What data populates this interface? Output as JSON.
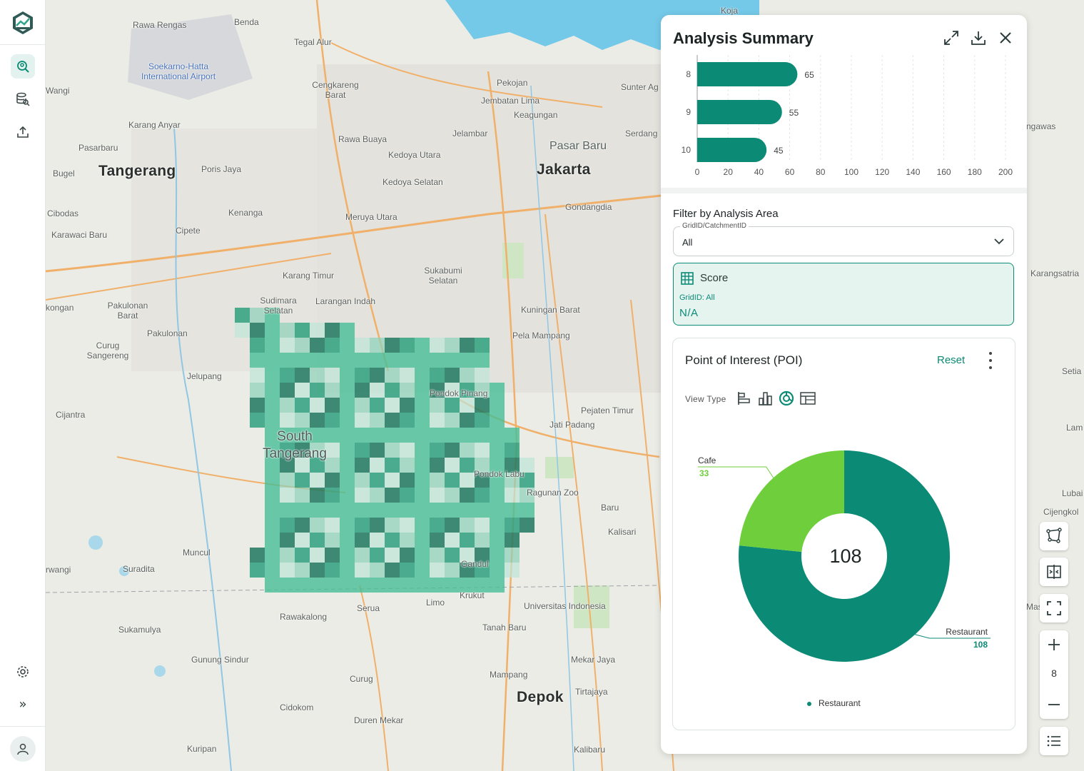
{
  "sidebar": {
    "logo": "app-logo",
    "items": [
      {
        "name": "analysis",
        "icon": "location-search-icon",
        "active": true
      },
      {
        "name": "datasets",
        "icon": "database-search-icon",
        "active": false
      },
      {
        "name": "upload",
        "icon": "upload-icon",
        "active": false
      }
    ],
    "settings_icon": "gear-icon",
    "expand_label": "»",
    "profile_icon": "user-icon"
  },
  "map": {
    "places": {
      "rawa_rengas": "Rawa Rengas",
      "benda": "Benda",
      "tegal_alur": "Tegal Alur",
      "airport": "Soekarno-Hatta International Airport",
      "cengkareng_barat": "Cengkareng Barat",
      "pekojan": "Pekojan",
      "sunter_agung": "Sunter Ag",
      "wangi": "Wangi",
      "karang_anyar": "Karang Anyar",
      "jembatan_lima": "Jembatan Lima",
      "keagungan": "Keagungan",
      "pasarbaru": "Pasarbaru",
      "rawa_buaya": "Rawa Buaya",
      "jelambar": "Jelambar",
      "serdang": "Serdang",
      "pasar_baru": "Pasar Baru",
      "bugel": "Bugel",
      "tangerang": "Tangerang",
      "poris_jaya": "Poris Jaya",
      "kedoya_utara": "Kedoya Utara",
      "jakarta": "Jakarta",
      "kedoya_selatan": "Kedoya Selatan",
      "cibodas": "Cibodas",
      "kenanga": "Kenanga",
      "meruya_utara": "Meruya Utara",
      "gondangdia": "Gondangdia",
      "karawaci_baru": "Karawaci Baru",
      "cipete": "Cipete",
      "karang_timur": "Karang Timur",
      "sukabumi_selatan": "Sukabumi Selatan",
      "pakulonan_barat": "Pakulonan Barat",
      "sudimara_selatan": "Sudimara Selatan",
      "larangan_indah": "Larangan Indah",
      "kuningan_barat": "Kuningan Barat",
      "pakulonan": "Pakulonan",
      "curug_sangereng": "Curug Sangereng",
      "pela_mampang": "Pela Mampang",
      "jelupang": "Jelupang",
      "pondok_pinang": "Pondok Pinang",
      "cijantra": "Cijantra",
      "south_tangerang": "South Tangerang",
      "pejaten_timur": "Pejaten Timur",
      "jati_padang": "Jati Padang",
      "pondok_labu": "Pondok Labu",
      "ragunan_zoo": "Ragunan Zoo",
      "baru": "Baru",
      "kalisari": "Kalisari",
      "muncul": "Muncul",
      "suradita": "Suradita",
      "gandul": "Gandul",
      "krukut": "Krukut",
      "limo": "Limo",
      "universitas_indonesia": "Universitas Indonesia",
      "rawakalong": "Rawakalong",
      "serua": "Serua",
      "sukamulya": "Sukamulya",
      "tanah_baru": "Tanah Baru",
      "gunung_sindur": "Gunung Sindur",
      "mekar_jaya": "Mekar Jaya",
      "curug": "Curug",
      "mampang": "Mampang",
      "depok": "Depok",
      "tirtajaya": "Tirtajaya",
      "cidokom": "Cidokom",
      "duren_mekar": "Duren Mekar",
      "kuripan": "Kuripan",
      "kalibaru": "Kalibaru",
      "koja": "Koja",
      "rwangi": "rwangi",
      "kongan": "kongan",
      "karangsatria": "Karangsatria",
      "setia": "Setia",
      "lam": "Lam",
      "lubai": "Lubai",
      "cijengkol": "Cijengkol",
      "mas": "Mas",
      "gawas": "ngawas"
    },
    "zoom_level": "8"
  },
  "panel": {
    "title": "Analysis Summary",
    "actions": [
      "expand-icon",
      "download-icon",
      "close-icon"
    ],
    "filter": {
      "title": "Filter by Analysis Area",
      "select_label": "GridID/CatchmentID",
      "select_value": "All"
    },
    "score": {
      "title": "Score",
      "grid": "GridID: All",
      "value": "N/A"
    },
    "poi": {
      "title": "Point of Interest (POI)",
      "reset": "Reset",
      "view_type_label": "View Type",
      "view_types": [
        "horizontal-bar-icon",
        "vertical-bar-icon",
        "donut-icon",
        "table-icon"
      ],
      "center_total": "108",
      "legend": "Restaurant"
    },
    "colors": {
      "primary": "#0b8a76",
      "secondary": "#6fce3b"
    }
  },
  "chart_data": [
    {
      "type": "bar",
      "orientation": "horizontal",
      "categories": [
        "8",
        "9",
        "10"
      ],
      "values": [
        65,
        55,
        45
      ],
      "xticks": [
        "0",
        "20",
        "40",
        "60",
        "80",
        "100",
        "120",
        "140",
        "160",
        "180",
        "200"
      ],
      "xlim": [
        0,
        200
      ],
      "grid": true
    },
    {
      "type": "pie",
      "donut": true,
      "slices": [
        {
          "label": "Restaurant",
          "value": 108,
          "color": "#0b8a76"
        },
        {
          "label": "Cafe",
          "value": 33,
          "color": "#6fce3b"
        }
      ]
    }
  ]
}
